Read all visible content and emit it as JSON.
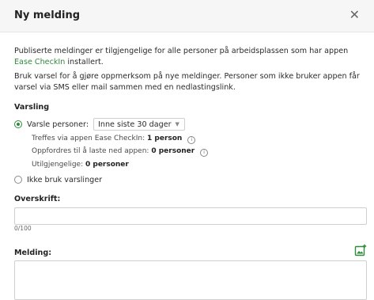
{
  "dialog": {
    "title": "Ny melding",
    "close_icon": "close-icon"
  },
  "intro": {
    "text_before_link": "Publiserte meldinger er tilgjengelige for alle personer på arbeidsplassen som har appen",
    "link": "Ease CheckIn",
    "text_after_link": "installert.",
    "notify_text": "Bruk varsel for å gjøre oppmerksom på nye meldinger. Personer som ikke bruker appen får varsel via SMS eller mail sammen med en nedlastingslink."
  },
  "notification": {
    "section_label": "Varsling",
    "option_notify_label": "Varsle personer:",
    "option_notify_checked": true,
    "period_select_value": "Inne siste 30 dager",
    "reached_label": "Treffes via appen Ease CheckIn:",
    "reached_value": "1 person",
    "encouraged_label": "Oppfordres til å laste ned appen:",
    "encouraged_value": "0 personer",
    "unavailable_label": "Utilgjengelige:",
    "unavailable_value": "0 personer",
    "option_none_label": "Ikke bruk varslinger",
    "option_none_checked": false
  },
  "headline": {
    "label": "Overskrift:",
    "value": "",
    "counter": "0/100"
  },
  "message": {
    "label": "Melding:",
    "value": "",
    "insert_image_icon": "insert-image-icon"
  },
  "colors": {
    "accent": "#2e8b3b",
    "header_bg": "#f6f6f6",
    "border": "#cfcfcf"
  }
}
